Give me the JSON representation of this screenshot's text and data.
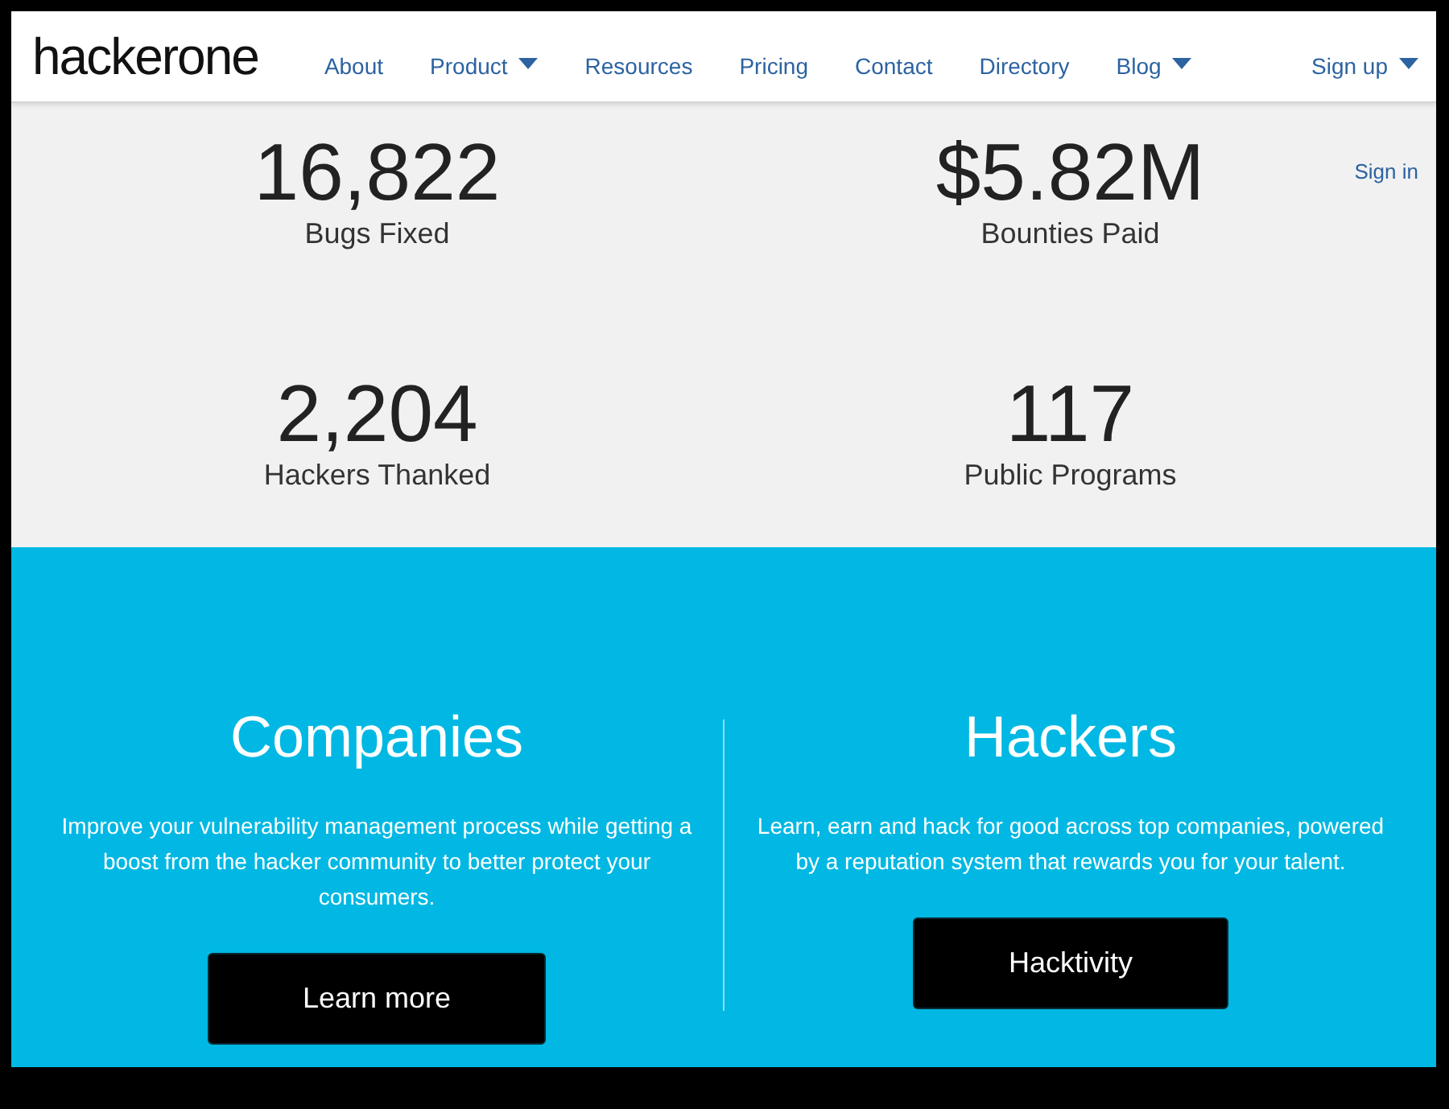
{
  "navbar": {
    "logo": "hackerone",
    "items": [
      {
        "label": "About",
        "dropdown": false
      },
      {
        "label": "Product",
        "dropdown": true
      },
      {
        "label": "Resources",
        "dropdown": false
      },
      {
        "label": "Pricing",
        "dropdown": false
      },
      {
        "label": "Contact",
        "dropdown": false
      },
      {
        "label": "Directory",
        "dropdown": false
      },
      {
        "label": "Blog",
        "dropdown": true
      }
    ],
    "sign_up": {
      "label": "Sign up",
      "dropdown": true
    }
  },
  "sign_in": {
    "label": "Sign in"
  },
  "stats": [
    {
      "value": "16,822",
      "label": "Bugs Fixed"
    },
    {
      "value": "$5.82M",
      "label": "Bounties Paid"
    },
    {
      "value": "2,204",
      "label": "Hackers Thanked"
    },
    {
      "value": "117",
      "label": "Public Programs"
    }
  ],
  "audiences": [
    {
      "title": "Companies",
      "text": "Improve your vulnerability management process while getting a boost from the hacker community to better protect your consumers.",
      "button": "Learn more"
    },
    {
      "title": "Hackers",
      "text": "Learn, earn and hack for good across top companies, powered by a reputation system that rewards you for your talent.",
      "button": "Hacktivity"
    }
  ]
}
